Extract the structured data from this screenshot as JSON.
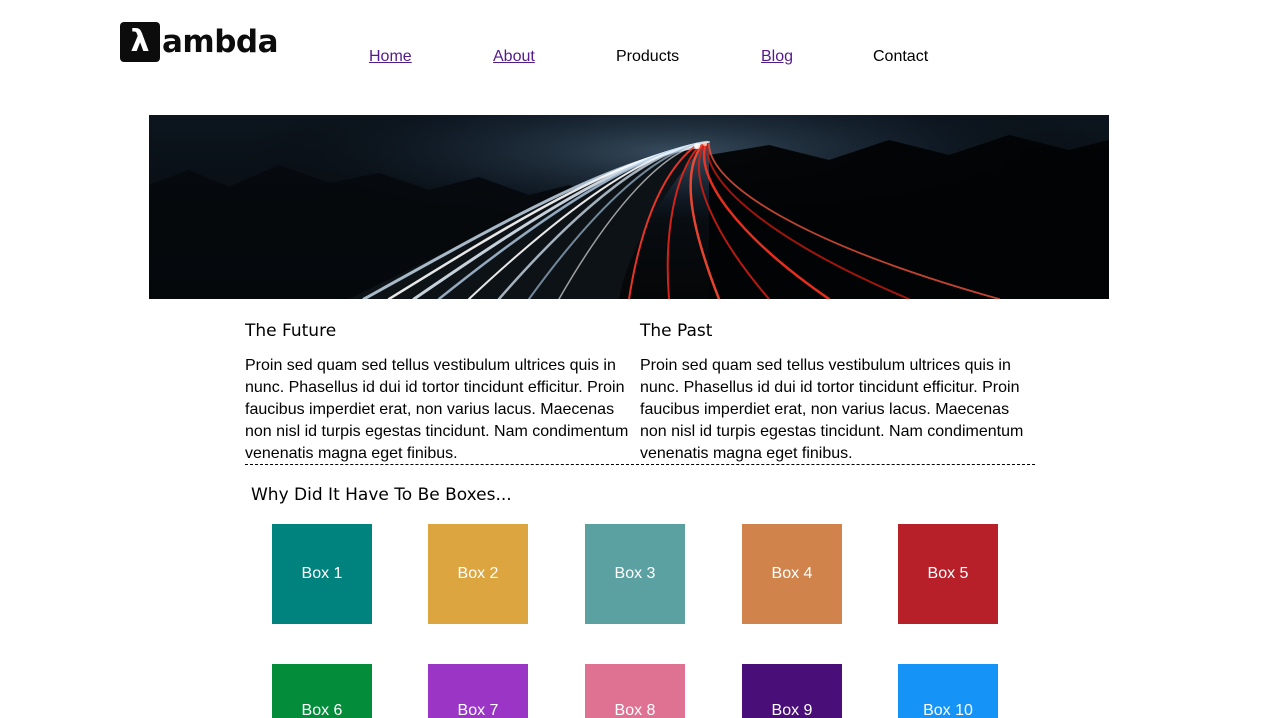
{
  "header": {
    "logo_mark": "λ",
    "logo_text": "ambda",
    "nav": [
      {
        "label": "Home",
        "style": "visited"
      },
      {
        "label": "About",
        "style": "visited"
      },
      {
        "label": "Products",
        "style": "plain"
      },
      {
        "label": "Blog",
        "style": "visited"
      },
      {
        "label": "Contact",
        "style": "plain"
      }
    ]
  },
  "hero": {
    "image": "long-exposure highway light trails at night"
  },
  "columns": [
    {
      "title": "The Future",
      "body": "Proin sed quam sed tellus vestibulum ultrices quis in nunc. Phasellus id dui id tortor tincidunt efficitur. Proin faucibus imperdiet erat, non varius lacus. Maecenas non nisl id turpis egestas tincidunt. Nam condimentum venenatis magna eget finibus."
    },
    {
      "title": "The Past",
      "body": "Proin sed quam sed tellus vestibulum ultrices quis in nunc. Phasellus id dui id tortor tincidunt efficitur. Proin faucibus imperdiet erat, non varius lacus. Maecenas non nisl id turpis egestas tincidunt. Nam condimentum venenatis magna eget finibus."
    }
  ],
  "boxes_section": {
    "title": "Why Did It Have To Be Boxes...",
    "boxes": [
      {
        "label": "Box 1",
        "color": "#00827f"
      },
      {
        "label": "Box 2",
        "color": "#dca540"
      },
      {
        "label": "Box 3",
        "color": "#5ba1a2"
      },
      {
        "label": "Box 4",
        "color": "#d0844b"
      },
      {
        "label": "Box 5",
        "color": "#b72029"
      },
      {
        "label": "Box 6",
        "color": "#038c3a"
      },
      {
        "label": "Box 7",
        "color": "#9b35c6"
      },
      {
        "label": "Box 8",
        "color": "#df7192"
      },
      {
        "label": "Box 9",
        "color": "#4a0e79"
      },
      {
        "label": "Box 10",
        "color": "#1593f6"
      }
    ]
  }
}
